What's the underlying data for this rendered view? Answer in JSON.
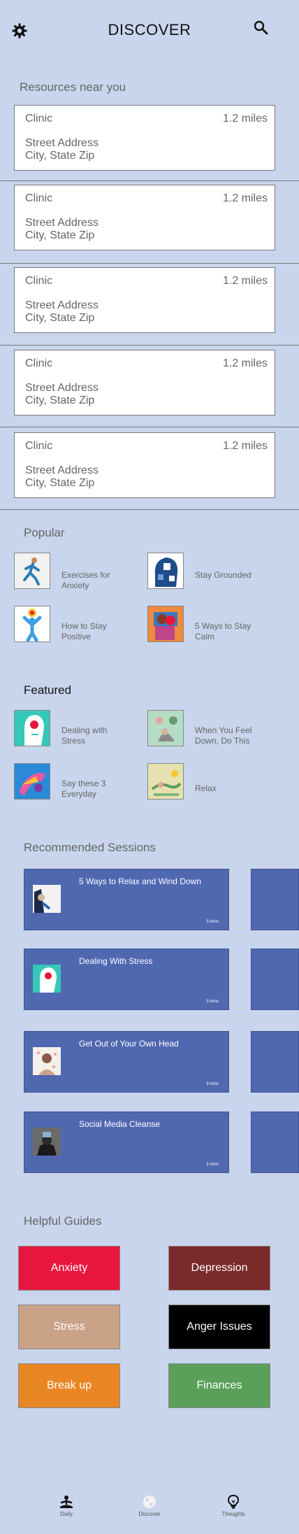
{
  "header": {
    "title": "DISCOVER",
    "settings_icon": "gear-icon",
    "search_icon": "search-icon"
  },
  "resources": {
    "title": "Resources near you",
    "clinics": [
      {
        "name": "Clinic",
        "distance": "1.2 miles",
        "street": "Street Address",
        "city": "City, State Zip"
      },
      {
        "name": "Clinic",
        "distance": "1.2 miles",
        "street": "Street Address",
        "city": "City, State Zip"
      },
      {
        "name": "Clinic",
        "distance": "1.2 miles",
        "street": "Street Address",
        "city": "City, State Zip"
      },
      {
        "name": "Clinic",
        "distance": "1.2 miles",
        "street": "Street Address",
        "city": "City, State Zip"
      },
      {
        "name": "Clinic",
        "distance": "1.2 miles",
        "street": "Street Address",
        "city": "City, State Zip"
      }
    ]
  },
  "popular": {
    "title": "Popular",
    "items": [
      {
        "label": "Exercises for Anxiety"
      },
      {
        "label": "Stay Grounded"
      },
      {
        "label": "How to Stay Positive"
      },
      {
        "label": "5 Ways to Stay Calm"
      }
    ]
  },
  "featured": {
    "title": "Featured",
    "items": [
      {
        "label": "Dealing with Stress"
      },
      {
        "label": "When You Feel Down, Do This"
      },
      {
        "label": "Say these 3 Everyday"
      },
      {
        "label": "Relax"
      }
    ]
  },
  "sessions": {
    "title": "Recommended Sessions",
    "items": [
      {
        "title": "5 Ways to Relax and Wind Down",
        "duration": "3 mins"
      },
      {
        "title": "Dealing With Stress",
        "duration": "3 mins"
      },
      {
        "title": "Get Out of Your Own Head",
        "duration": "3 mins"
      },
      {
        "title": "Social Media Cleanse",
        "duration": "3 mins"
      }
    ]
  },
  "guides": {
    "title": "Helpful Guides",
    "items": [
      {
        "label": "Anxiety",
        "color": "#e8163c"
      },
      {
        "label": "Depression",
        "color": "#7b2a2a"
      },
      {
        "label": "Stress",
        "color": "#c9a287"
      },
      {
        "label": "Anger Issues",
        "color": "#000000"
      },
      {
        "label": "Break up",
        "color": "#e88624"
      },
      {
        "label": "Finances",
        "color": "#5aa05a"
      }
    ]
  },
  "tabbar": {
    "items": [
      {
        "label": "Daily",
        "icon": "meditation-icon"
      },
      {
        "label": "Discover",
        "icon": "globe-icon"
      },
      {
        "label": "Thoughts",
        "icon": "lightbulb-icon"
      }
    ]
  }
}
